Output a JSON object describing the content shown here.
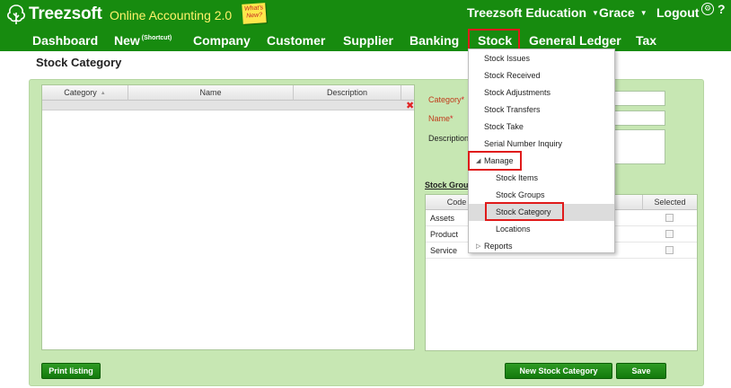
{
  "header": {
    "logo_text": "Treezsoft",
    "tagline": "Online Accounting 2.0",
    "whats_new": "What's New?",
    "org_menu": "Treezsoft Education",
    "user_menu": "Grace",
    "logout": "Logout",
    "help": "?"
  },
  "nav": {
    "items": [
      {
        "label": "Dashboard"
      },
      {
        "label": "New",
        "sup": "(Shortcut)"
      },
      {
        "label": "Company"
      },
      {
        "label": "Customer"
      },
      {
        "label": "Supplier"
      },
      {
        "label": "Banking"
      },
      {
        "label": "Stock"
      },
      {
        "label": "General Ledger"
      },
      {
        "label": "Tax"
      }
    ],
    "active": "Stock"
  },
  "page": {
    "title": "Stock Category"
  },
  "category_grid": {
    "columns": [
      "Category",
      "Name",
      "Description"
    ],
    "rows": []
  },
  "form": {
    "category_label": "Category",
    "name_label": "Name",
    "description_label": "Description",
    "required_marker": "*",
    "category_value": "",
    "name_value": "",
    "description_value": ""
  },
  "stock_groups": {
    "title": "Stock Group",
    "columns": [
      "Code",
      "Description",
      "Selected"
    ],
    "rows": [
      {
        "code": "Assets",
        "selected": false
      },
      {
        "code": "Product",
        "selected": false
      },
      {
        "code": "Service",
        "selected": false
      }
    ]
  },
  "buttons": {
    "print_listing": "Print listing",
    "new_stock_category": "New Stock Category",
    "save": "Save"
  },
  "stock_menu": {
    "items": [
      {
        "label": "Stock Issues"
      },
      {
        "label": "Stock Received"
      },
      {
        "label": "Stock Adjustments"
      },
      {
        "label": "Stock Transfers"
      },
      {
        "label": "Stock Take"
      },
      {
        "label": "Serial Number Inquiry"
      }
    ],
    "manage": {
      "label": "Manage",
      "children": [
        {
          "label": "Stock Items"
        },
        {
          "label": "Stock Groups"
        },
        {
          "label": "Stock Category"
        },
        {
          "label": "Locations"
        }
      ]
    },
    "reports": {
      "label": "Reports"
    },
    "selected": "Stock Category"
  },
  "colors": {
    "header_green": "#178b0f",
    "panel_green": "#c7e7b3",
    "highlight_red": "#e01b1b",
    "tagline_yellow": "#fff36b"
  }
}
